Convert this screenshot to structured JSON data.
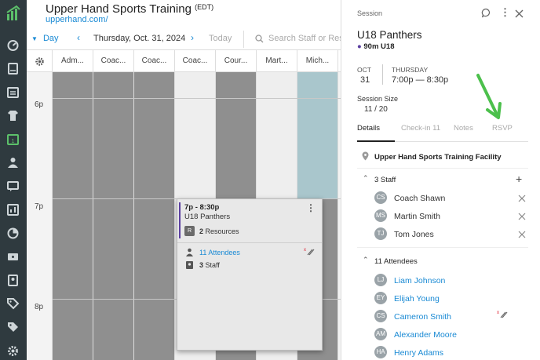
{
  "header": {
    "title": "Upper Hand Sports Training",
    "timezone": "(EDT)",
    "url": "upperhand.com/"
  },
  "toolbar": {
    "view": "Day",
    "date": "Thursday, Oct. 31, 2024",
    "today_label": "Today",
    "search_placeholder": "Search Staff or Resources"
  },
  "columns": [
    "Adm...",
    "Coac...",
    "Coac...",
    "Coac...",
    "Cour...",
    "Mart...",
    "Mich..."
  ],
  "times": [
    "6p",
    "7p",
    "8p"
  ],
  "event_card": {
    "time": "7p - 8:30p",
    "name": "U18 Panthers",
    "resource_badge": "R",
    "resources_count": "2",
    "resources_label": "Resources",
    "attendees_label": "11 Attendees",
    "staff_count": "3",
    "staff_label": "Staff"
  },
  "panel": {
    "header_label": "Session",
    "title": "U18 Panthers",
    "subtitle": "90m U18",
    "month": "OCT",
    "day": "31",
    "weekday": "THURSDAY",
    "time_range": "7:00p — 8:30p",
    "session_size_label": "Session Size",
    "session_size_value": "11 / 20",
    "tabs": [
      "Details",
      "Check-in 11",
      "Notes",
      "RSVP"
    ],
    "location": "Upper Hand Sports Training Facility",
    "staff_header": "3 Staff",
    "staff": [
      {
        "initials": "CS",
        "name": "Coach Shawn"
      },
      {
        "initials": "MS",
        "name": "Martin Smith"
      },
      {
        "initials": "TJ",
        "name": "Tom Jones"
      }
    ],
    "attendees_header": "11 Attendees",
    "attendees": [
      {
        "initials": "LJ",
        "name": "Liam Johnson"
      },
      {
        "initials": "EY",
        "name": "Elijah Young"
      },
      {
        "initials": "CS",
        "name": "Cameron Smith"
      },
      {
        "initials": "AM",
        "name": "Alexander Moore"
      },
      {
        "initials": "HA",
        "name": "Henry Adams"
      }
    ]
  },
  "colors": {
    "accent": "#1a8ad4",
    "rail": "#2f3a3f",
    "logo": "#5cc06a",
    "highlight_col": "#a9c6cc",
    "arrow": "#4cc04c",
    "event_bar": "#5b3fa0"
  }
}
